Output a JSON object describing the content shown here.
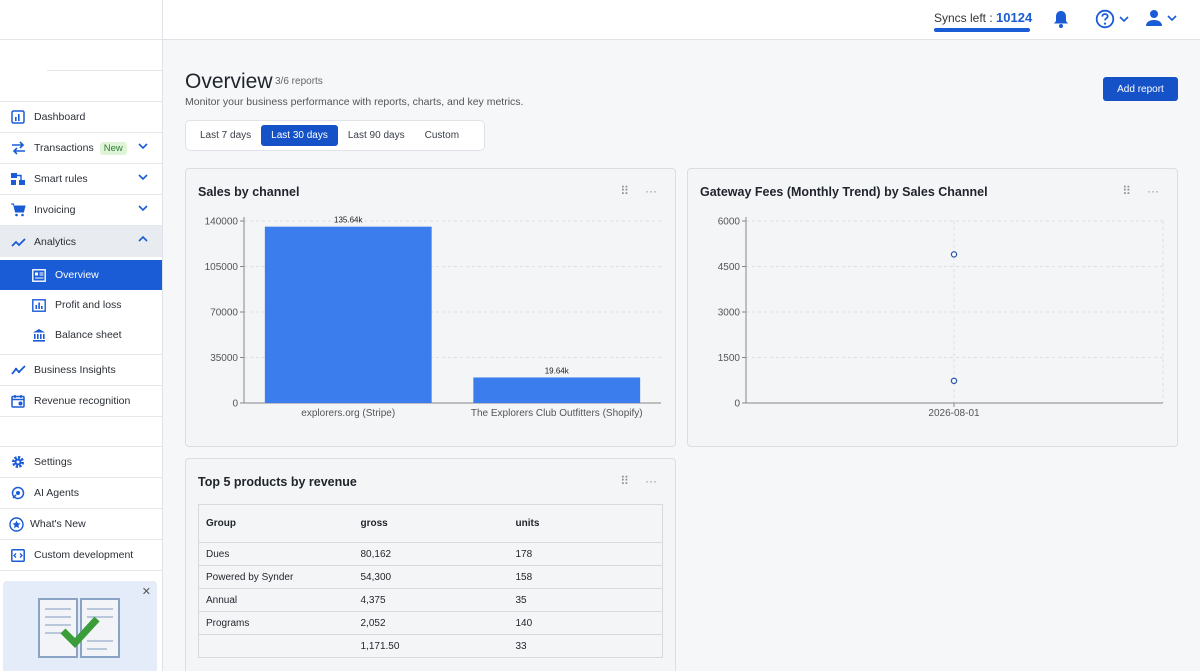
{
  "topbar": {
    "syncs_label": "Syncs left :",
    "syncs_value": "10124"
  },
  "sidebar": {
    "items": [
      {
        "label": "Dashboard"
      },
      {
        "label": "Transactions",
        "badge": "New"
      },
      {
        "label": "Smart rules"
      },
      {
        "label": "Invoicing"
      },
      {
        "label": "Analytics"
      }
    ],
    "analytics_sub": [
      {
        "label": "Overview"
      },
      {
        "label": "Profit and loss"
      },
      {
        "label": "Balance sheet"
      }
    ],
    "more_items": [
      {
        "label": "Business Insights"
      },
      {
        "label": "Revenue recognition"
      }
    ],
    "bottom_items": [
      {
        "label": "Settings"
      },
      {
        "label": "AI Agents"
      },
      {
        "label": "What's New"
      },
      {
        "label": "Custom development"
      }
    ]
  },
  "page": {
    "title": "Overview",
    "count": "3/6 reports",
    "subtitle": "Monitor your business performance with reports, charts, and key metrics.",
    "add_report": "Add report",
    "ranges": [
      "Last 7 days",
      "Last 30 days",
      "Last 90 days",
      "Custom"
    ],
    "selected_range": "Last 30 days"
  },
  "colors": {
    "accent": "#1a5bd6",
    "bar": "#3b7ded"
  },
  "cards": {
    "sales": {
      "title": "Sales by channel"
    },
    "fees": {
      "title": "Gateway Fees (Monthly Trend) by Sales Channel"
    },
    "products": {
      "title": "Top 5 products by revenue",
      "columns": [
        "Group",
        "gross",
        "units"
      ],
      "rows": [
        [
          "Dues",
          "80,162",
          "178"
        ],
        [
          "Powered by Synder",
          "54,300",
          "158"
        ],
        [
          "Annual",
          "4,375",
          "35"
        ],
        [
          "Programs",
          "2,052",
          "140"
        ],
        [
          "",
          "1,171.50",
          "33"
        ]
      ]
    }
  },
  "chart_data": [
    {
      "type": "bar",
      "title": "Sales by channel",
      "categories": [
        "explorers.org (Stripe)",
        "The Explorers Club Outfitters (Shopify)"
      ],
      "values": [
        135640,
        19640
      ],
      "data_labels": [
        "135.64k",
        "19.64k"
      ],
      "yticks": [
        0,
        35000,
        70000,
        105000,
        140000
      ],
      "ylim": [
        0,
        140000
      ],
      "grid": true
    },
    {
      "type": "scatter",
      "title": "Gateway Fees (Monthly Trend) by Sales Channel",
      "x": [
        "2026-08-01",
        "2026-08-01"
      ],
      "y": [
        4900,
        730
      ],
      "yticks": [
        0,
        1500,
        3000,
        4500,
        6000
      ],
      "ylim": [
        0,
        6000
      ],
      "grid": true
    }
  ]
}
